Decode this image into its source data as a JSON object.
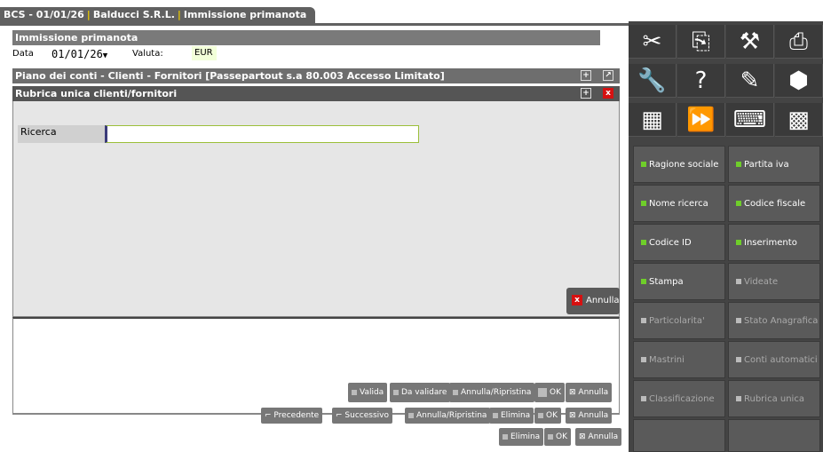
{
  "tab": {
    "seg1": "BCS - 01/01/26",
    "seg2": "Balducci S.R.L.",
    "seg3": "Immissione primanota"
  },
  "window": {
    "title": "Immissione primanota",
    "date_label": "Data",
    "date_value": "01/01/26",
    "currency_label": "Valuta:",
    "currency_value": "EUR"
  },
  "piano_bar": {
    "title": "Piano dei conti - Clienti - Fornitori [Passepartout s.a 80.003 Accesso Limitato]"
  },
  "rubrica": {
    "title": "Rubrica unica clienti/fornitori",
    "search_label": "Ricerca",
    "search_value": "",
    "annulla_label": "Annulla"
  },
  "row_buttons_1": [
    "Valida",
    "Da validare",
    "Annulla/Ripristina",
    "OK",
    "Annulla"
  ],
  "row_buttons_2": [
    "Precedente",
    "Successivo",
    "Annulla/Ripristina",
    "Elimina",
    "OK",
    "Annulla"
  ],
  "row_buttons_3": [
    "Elimina",
    "OK",
    "Annulla"
  ],
  "icons": [
    "scissors-icon",
    "copy-icon",
    "tool-icon",
    "printer-icon",
    "wrench-icon",
    "help-icon",
    "notebook-icon",
    "box-icon",
    "calculator-icon",
    "fast-forward-icon",
    "keyboard-icon",
    "grid-icon"
  ],
  "function_buttons": [
    {
      "label": "Ragione sociale",
      "enabled": true
    },
    {
      "label": "Partita iva",
      "enabled": true
    },
    {
      "label": "Nome ricerca",
      "enabled": true
    },
    {
      "label": "Codice fiscale",
      "enabled": true
    },
    {
      "label": "Codice ID",
      "enabled": true
    },
    {
      "label": "Inserimento",
      "enabled": true
    },
    {
      "label": "Stampa",
      "enabled": true
    },
    {
      "label": "Videate",
      "enabled": false
    },
    {
      "label": "Particolarita'",
      "enabled": false
    },
    {
      "label": "Stato Anagrafica",
      "enabled": false
    },
    {
      "label": "Mastrini",
      "enabled": false
    },
    {
      "label": "Conti automatici",
      "enabled": false
    },
    {
      "label": "Classificazione",
      "enabled": false
    },
    {
      "label": "Rubrica unica",
      "enabled": false
    }
  ],
  "colors": {
    "accent_green": "#6fce2a",
    "close_red": "#d61111",
    "panel": "#444444"
  }
}
